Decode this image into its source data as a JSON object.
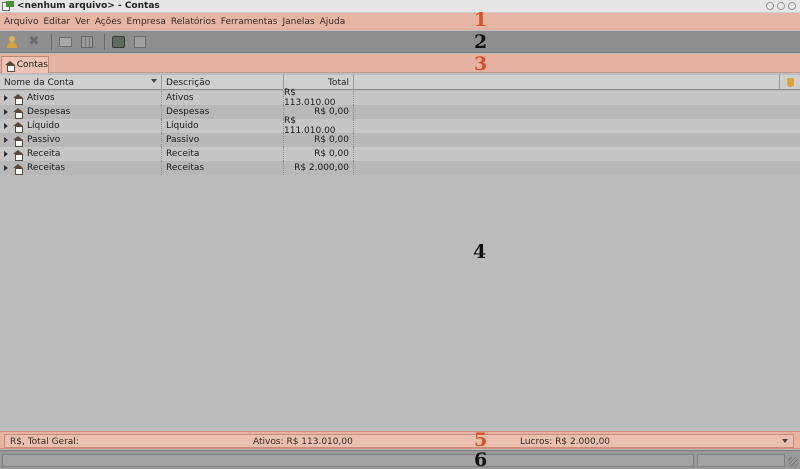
{
  "window": {
    "title": "<nenhum arquivo> - Contas"
  },
  "menu": [
    "Arquivo",
    "Editar",
    "Ver",
    "Ações",
    "Empresa",
    "Relatórios",
    "Ferramentas",
    "Janelas",
    "Ajuda"
  ],
  "annotations": [
    "1",
    "2",
    "3",
    "4",
    "5",
    "6"
  ],
  "tab": {
    "label": "Contas"
  },
  "table": {
    "columns": {
      "name": "Nome da Conta",
      "description": "Descrição",
      "total": "Total"
    },
    "rows": [
      {
        "name": "Ativos",
        "description": "Ativos",
        "total": "R$ 113.010,00"
      },
      {
        "name": "Despesas",
        "description": "Despesas",
        "total": "R$ 0,00"
      },
      {
        "name": "Líquido",
        "description": "Líquido",
        "total": "R$ 111.010,00"
      },
      {
        "name": "Passivo",
        "description": "Passivo",
        "total": "R$ 0,00"
      },
      {
        "name": "Receita",
        "description": "Receita",
        "total": "R$ 0,00"
      },
      {
        "name": "Receitas",
        "description": "Receitas",
        "total": "R$ 2.000,00"
      }
    ]
  },
  "summary": {
    "label": "R$, Total Geral:",
    "assets": "Ativos: R$ 113.010,00",
    "profits": "Lucros: R$ 2.000,00"
  },
  "colors": {
    "highlight": "#e7b5a4",
    "annotation_red": "#d9502a"
  }
}
